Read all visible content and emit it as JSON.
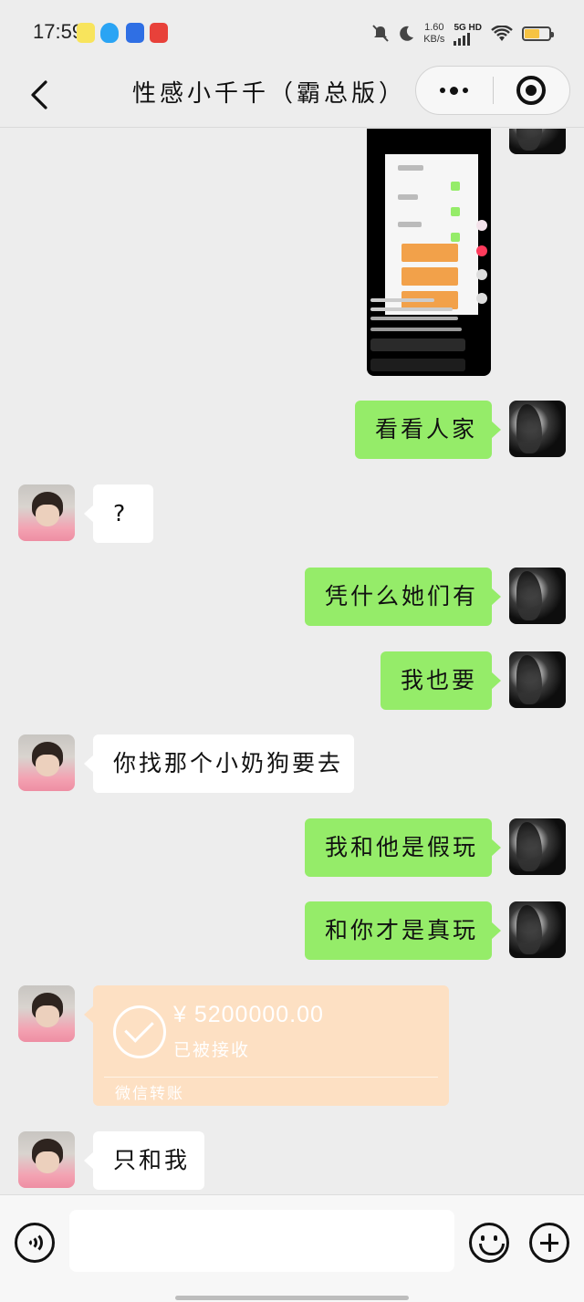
{
  "status_bar": {
    "time": "17:59",
    "net_speed_value": "1.60",
    "net_speed_unit": "KB/s",
    "network_type": "5G HD",
    "battery_color": "#f6c343"
  },
  "nav": {
    "title": "性感小千千（霸总版）"
  },
  "messages": {
    "m1": "看看人家",
    "m2": "?",
    "m3": "凭什么她们有",
    "m4": "我也要",
    "m5": "你找那个小奶狗要去",
    "m6": "我和他是假玩",
    "m7": "和你才是真玩",
    "m9": "只和我"
  },
  "transfer": {
    "amount": "¥ 5200000.00",
    "status": "已被接收",
    "footer": "微信转账"
  },
  "colors": {
    "bubble_me": "#95ec69",
    "bubble_her": "#ffffff",
    "transfer_bg": "#fde0c3",
    "background": "#ededed"
  },
  "icons": {
    "back": "chevron-left-icon",
    "more": "more-dots-icon",
    "close": "target-icon",
    "voice": "voice-icon",
    "emoji": "emoji-icon",
    "plus": "plus-icon"
  }
}
